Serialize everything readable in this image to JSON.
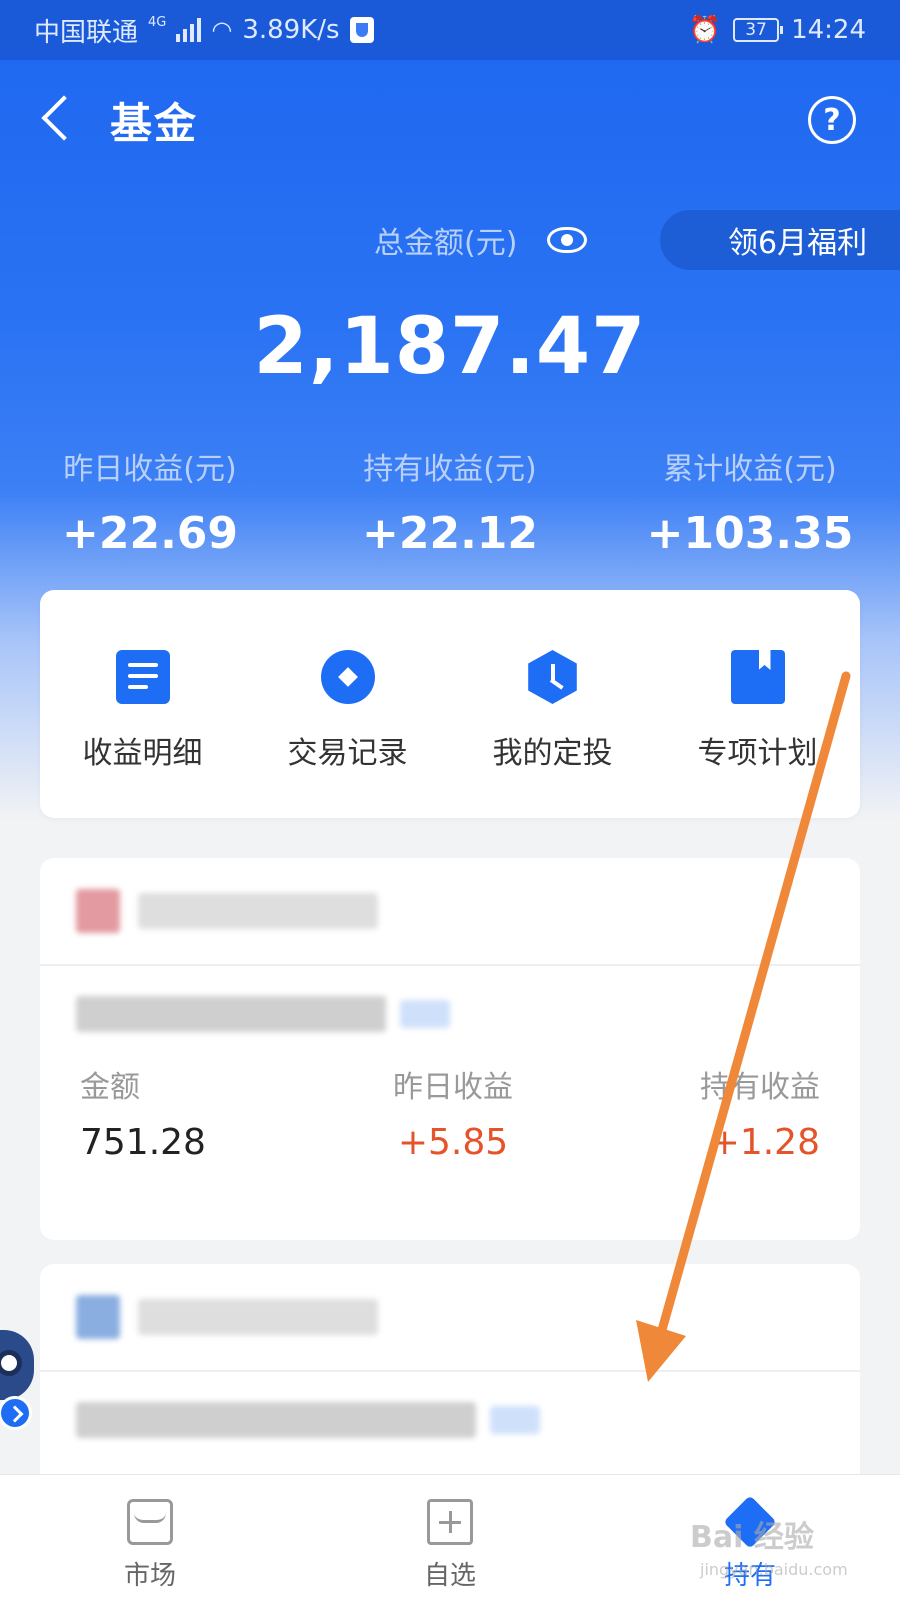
{
  "status_bar": {
    "carrier": "中国联通",
    "network": "4G",
    "speed": "3.89K/s",
    "battery": "37",
    "time": "14:24"
  },
  "nav": {
    "title": "基金"
  },
  "summary": {
    "total_label": "总金额(元)",
    "total_amount": "2,187.47",
    "promo_label": "领6月福利",
    "stats": [
      {
        "label": "昨日收益(元)",
        "value": "+22.69"
      },
      {
        "label": "持有收益(元)",
        "value": "+22.12"
      },
      {
        "label": "累计收益(元)",
        "value": "+103.35"
      }
    ]
  },
  "quick_actions": [
    {
      "label": "收益明细",
      "icon": "document-icon"
    },
    {
      "label": "交易记录",
      "icon": "record-icon"
    },
    {
      "label": "我的定投",
      "icon": "clock-icon"
    },
    {
      "label": "专项计划",
      "icon": "bookmark-icon"
    }
  ],
  "fund": {
    "amount_label": "金额",
    "amount_value": "751.28",
    "yesterday_label": "昨日收益",
    "yesterday_value": "+5.85",
    "holding_label": "持有收益",
    "holding_value": "+1.28"
  },
  "tabs": [
    {
      "label": "市场",
      "icon": "store-icon"
    },
    {
      "label": "自选",
      "icon": "add-favorite-icon"
    },
    {
      "label": "持有",
      "icon": "holding-icon"
    }
  ],
  "watermark": {
    "text": "Bai 经验",
    "sub": "jingyan.baidu.com"
  },
  "colors": {
    "primary": "#1e6ef5",
    "gain": "#e5532a",
    "arrow": "#f0883a"
  }
}
